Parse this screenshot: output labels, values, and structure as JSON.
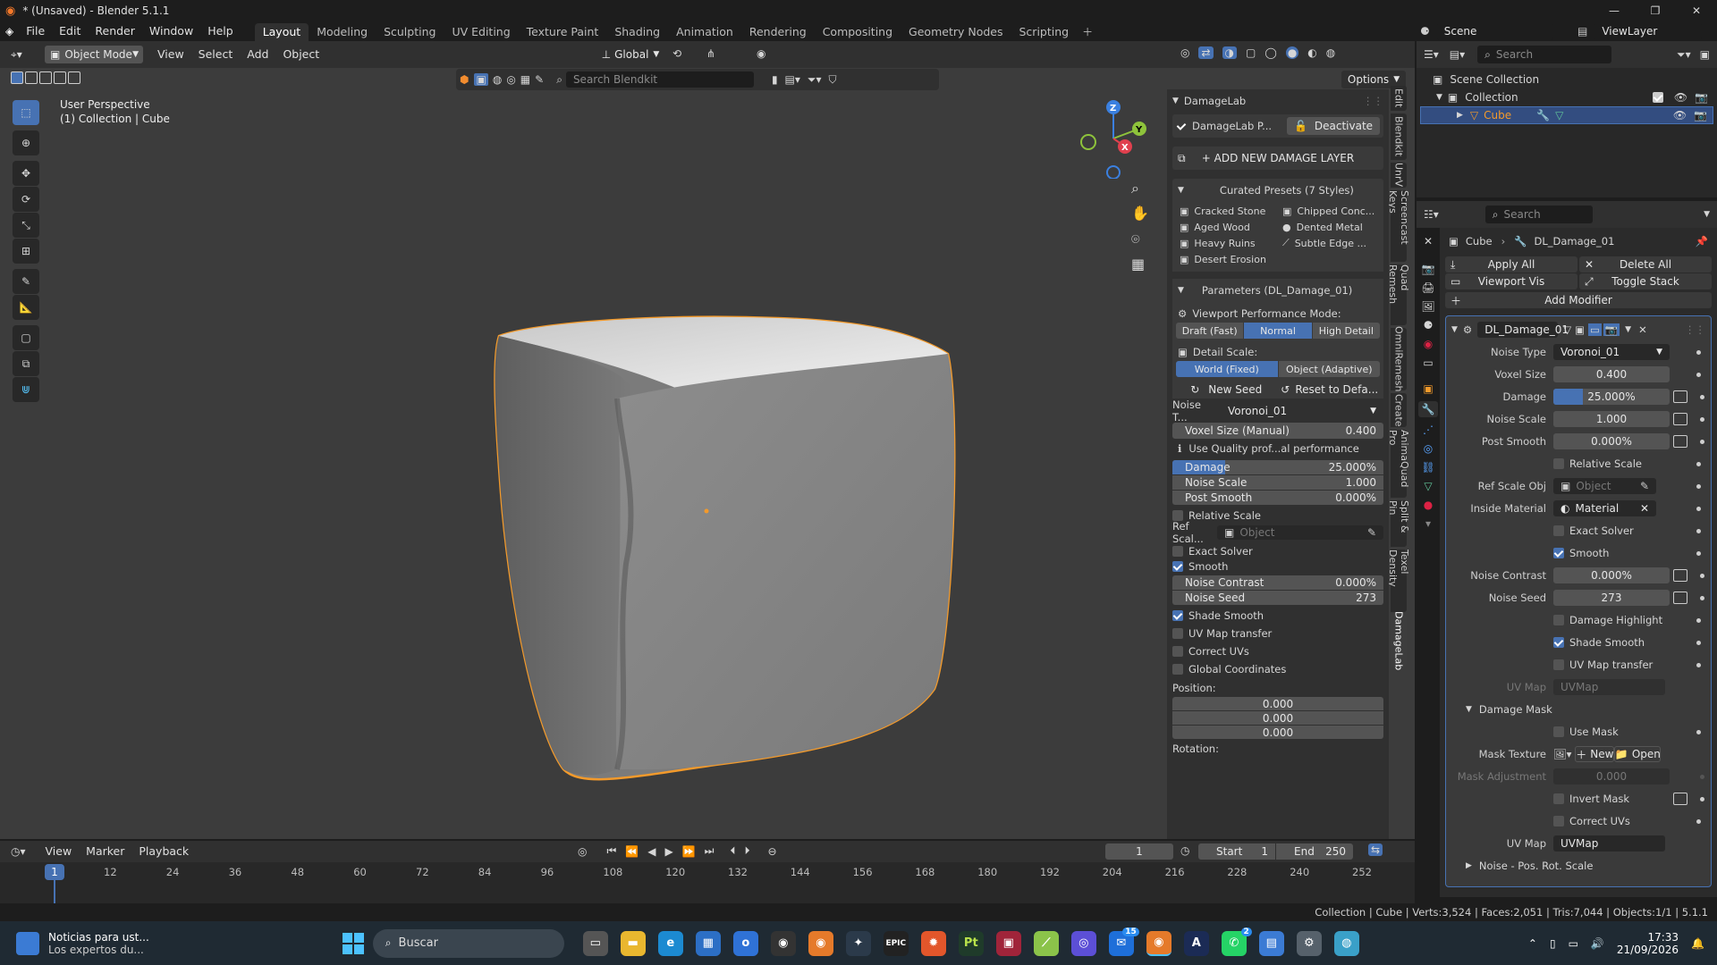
{
  "window": {
    "title": "* (Unsaved) - Blender 5.1.1"
  },
  "menu": [
    "File",
    "Edit",
    "Render",
    "Window",
    "Help"
  ],
  "workspaces": [
    "Layout",
    "Modeling",
    "Sculpting",
    "UV Editing",
    "Texture Paint",
    "Shading",
    "Animation",
    "Rendering",
    "Compositing",
    "Geometry Nodes",
    "Scripting"
  ],
  "active_workspace": "Layout",
  "scene": {
    "name": "Scene",
    "view_layer": "ViewLayer"
  },
  "viewport_header": {
    "mode": "Object Mode",
    "menus": [
      "View",
      "Select",
      "Add",
      "Object"
    ],
    "orientation": "Global",
    "options": "Options",
    "search_placeholder": "Search Blendkit"
  },
  "viewport": {
    "view_name": "User Perspective",
    "collection_label": "(1) Collection | Cube"
  },
  "gizmo": {
    "z": "Z",
    "y": "Y",
    "x": "X"
  },
  "npanel_tabs": [
    "Edit",
    "Blendkit",
    "UnrV",
    "Screencast Keys",
    "Quad Remesh",
    "OmniRemesh",
    "Create",
    "AnimaQuad Pro",
    "Split & Pin",
    "Texel Density",
    "DamageLab"
  ],
  "damagelab": {
    "title": "DamageLab",
    "active_label": "DamageLab P...",
    "deactivate": "Deactivate",
    "add_layer": "+ ADD NEW DAMAGE LAYER",
    "presets_title": "Curated Presets (7 Styles)",
    "presets": [
      "Cracked Stone",
      "Chipped Conc...",
      "Aged Wood",
      "Dented Metal",
      "Heavy Ruins",
      "Subtle Edge ...",
      "Desert Erosion"
    ],
    "params_title": "Parameters (DL_Damage_01)",
    "perf_label": "Viewport Performance Mode:",
    "perf_modes": [
      "Draft (Fast)",
      "Normal",
      "High Detail"
    ],
    "perf_active": "Normal",
    "detail_label": "Detail Scale:",
    "detail_modes": [
      "World (Fixed)",
      "Object (Adaptive)"
    ],
    "new_seed": "New Seed",
    "reset": "Reset to Defa...",
    "noise_type_label": "Noise T...",
    "noise_type": "Voronoi_01",
    "voxel_label": "Voxel Size (Manual)",
    "voxel_value": "0.400",
    "quality_info": "Use Quality prof...al performance",
    "damage_label": "Damage",
    "damage_value": "25.000%",
    "damage_fraction": 0.25,
    "noise_scale_label": "Noise Scale",
    "noise_scale_value": "1.000",
    "post_smooth_label": "Post Smooth",
    "post_smooth_value": "0.000%",
    "relative_scale": "Relative Scale",
    "ref_scale_label": "Ref Scal...",
    "ref_placeholder": "Object",
    "exact_solver": "Exact Solver",
    "smooth": "Smooth",
    "noise_contrast_label": "Noise Contrast",
    "noise_contrast_value": "0.000%",
    "noise_seed_label": "Noise Seed",
    "noise_seed_value": "273",
    "shade_smooth": "Shade Smooth",
    "uv_map_transfer": "UV Map transfer",
    "correct_uvs": "Correct UVs",
    "global_coords": "Global Coordinates",
    "position_label": "Position:",
    "position": [
      "0.000",
      "0.000",
      "0.000"
    ],
    "rotation_label": "Rotation:"
  },
  "outliner": {
    "search_placeholder": "Search",
    "scene_collection": "Scene Collection",
    "collection": "Collection",
    "object": "Cube"
  },
  "properties": {
    "search_placeholder": "Search",
    "breadcrumb_obj": "Cube",
    "breadcrumb_mod": "DL_Damage_01",
    "apply_all": "Apply All",
    "delete_all": "Delete All",
    "viewport_vis": "Viewport Vis",
    "toggle_stack": "Toggle Stack",
    "add_modifier": "Add Modifier",
    "modifier_name": "DL_Damage_01",
    "fields": {
      "noise_type_l": "Noise Type",
      "noise_type_v": "Voronoi_01",
      "voxel_l": "Voxel Size",
      "voxel_v": "0.400",
      "damage_l": "Damage",
      "damage_v": "25.000%",
      "noise_scale_l": "Noise Scale",
      "noise_scale_v": "1.000",
      "post_smooth_l": "Post Smooth",
      "post_smooth_v": "0.000%",
      "relative_scale": "Relative Scale",
      "ref_scale_l": "Ref Scale Obj",
      "ref_scale_ph": "Object",
      "inside_mat_l": "Inside Material",
      "inside_mat_v": "Material",
      "exact_solver": "Exact Solver",
      "smooth": "Smooth",
      "noise_contrast_l": "Noise Contrast",
      "noise_contrast_v": "0.000%",
      "noise_seed_l": "Noise Seed",
      "noise_seed_v": "273",
      "damage_highlight": "Damage Highlight",
      "shade_smooth": "Shade Smooth",
      "uv_map_transfer": "UV Map transfer",
      "uv_map_l": "UV Map",
      "uv_map_ph": "UVMap",
      "damage_mask": "Damage Mask",
      "use_mask": "Use Mask",
      "mask_texture_l": "Mask Texture",
      "mask_new": "New",
      "mask_open": "Open",
      "mask_adj_l": "Mask Adjustment",
      "mask_adj_v": "0.000",
      "invert_mask": "Invert Mask",
      "correct_uvs": "Correct UVs",
      "uv_map2_l": "UV Map",
      "uv_map2_v": "UVMap",
      "noise_pos": "Noise - Pos. Rot. Scale"
    }
  },
  "timeline": {
    "menus": [
      "View",
      "Marker",
      "Playback"
    ],
    "current_frame": "1",
    "start_label": "Start",
    "start": "1",
    "end_label": "End",
    "end": "250",
    "ticks": [
      "12",
      "24",
      "36",
      "48",
      "60",
      "72",
      "84",
      "96",
      "108",
      "120",
      "132",
      "144",
      "156",
      "168",
      "180",
      "192",
      "204",
      "216",
      "228",
      "240",
      "252"
    ],
    "playhead": "1"
  },
  "statusbar": {
    "text": "Collection | Cube | Verts:3,524 | Faces:2,051 | Tris:7,044 | Objects:1/1 | 5.1.1"
  },
  "taskbar": {
    "news_title": "Noticias para ust...",
    "news_sub": "Los expertos du...",
    "search": "Buscar",
    "time": "17:33",
    "date": "21/09/2026",
    "badges": {
      "mail": "15",
      "whatsapp": "2"
    }
  },
  "colors": {
    "accent": "#4772b3",
    "selection": "#f7a13a",
    "bg": "#1d1d1d",
    "panel": "#303030"
  }
}
